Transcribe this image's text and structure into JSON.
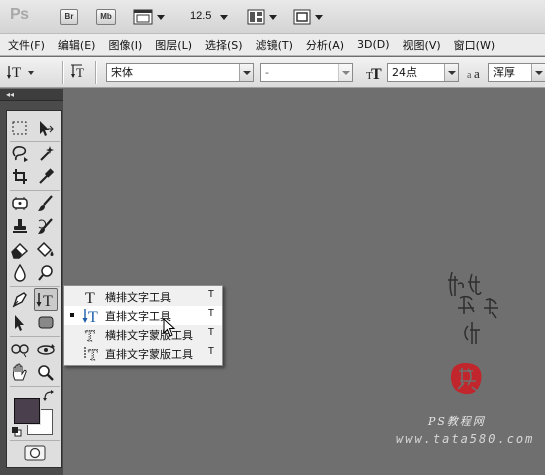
{
  "app": {
    "logo": "Ps",
    "bridge_label": "Br",
    "minibridge_label": "Mb",
    "zoom": "12.5"
  },
  "menu": [
    "文件(F)",
    "编辑(E)",
    "图像(I)",
    "图层(L)",
    "选择(S)",
    "滤镜(T)",
    "分析(A)",
    "3D(D)",
    "视图(V)",
    "窗口(W)"
  ],
  "options": {
    "font_family": "宋体",
    "font_style": "-",
    "font_size": "24点",
    "antialias": "浑厚"
  },
  "flyout": {
    "items": [
      {
        "label": "横排文字工具",
        "key": "T",
        "selected": false
      },
      {
        "label": "直排文字工具",
        "key": "T",
        "selected": true
      },
      {
        "label": "横排文字蒙版工具",
        "key": "T",
        "selected": false
      },
      {
        "label": "直排文字蒙版工具",
        "key": "T",
        "selected": false
      }
    ]
  },
  "watermark": {
    "signature": "他她我帮你",
    "label": "PS教程网",
    "site": "www.tata580.com"
  },
  "colors": {
    "canvas": "#6f6f6f",
    "foreground": "#4a3f4c",
    "background": "#ffffff",
    "seal": "#c0262b"
  },
  "panel": {
    "collapse": "◂◂"
  }
}
